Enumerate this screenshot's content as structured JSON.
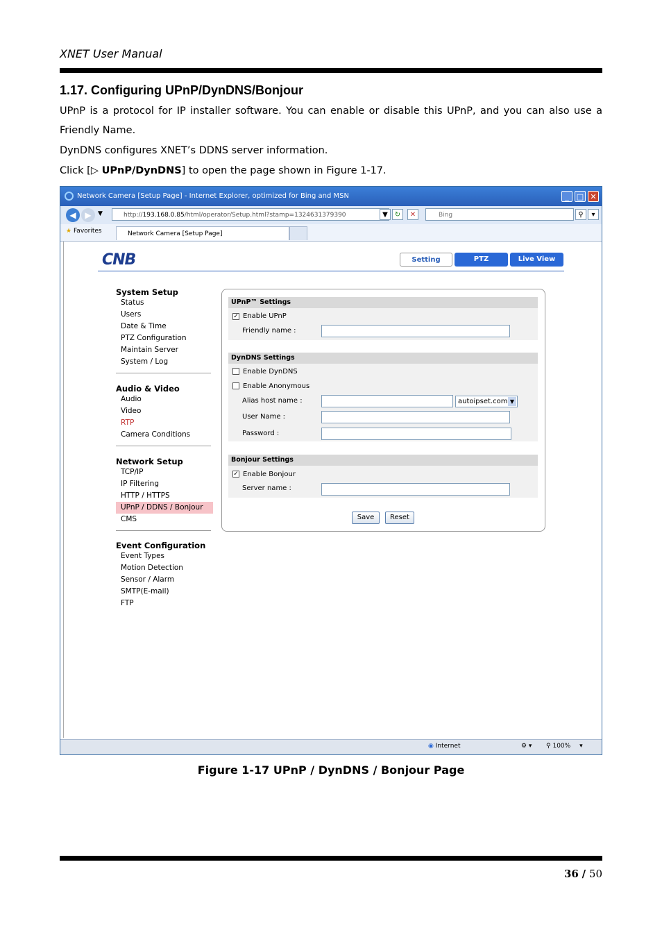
{
  "header": {
    "title": "XNET User Manual"
  },
  "section": {
    "title": "1.17. Configuring UPnP/DynDNS/Bonjour",
    "p1": "UPnP is a protocol for IP installer software. You can enable or disable this UPnP, and you can also use a Friendly Name.",
    "p2": "DynDNS configures XNET’s DDNS server information.",
    "p3_pre": "Click [",
    "p3_icon": "▷",
    "p3_bold": "UPnP/DynDNS",
    "p3_post": "] to open the page shown in Figure 1-17."
  },
  "browser": {
    "window_title": "Network Camera [Setup Page] - Internet Explorer, optimized for Bing and MSN",
    "address_prefix": "http://",
    "address_host": "193.168.0.85",
    "address_rest": "/html/operator/Setup.html?stamp=1324631379390",
    "search_placeholder": "Bing",
    "favorites_label": "Favorites",
    "tab_label": "Network Camera [Setup Page]",
    "status_zone": "Internet",
    "zoom": "100%"
  },
  "camera_ui": {
    "logo": "CNB",
    "tabs": {
      "setting": "Setting",
      "ptz": "PTZ",
      "live": "Live View"
    },
    "menu": {
      "system_setup": {
        "title": "System Setup",
        "items": [
          "Status",
          "Users",
          "Date & Time",
          "PTZ Configuration",
          "Maintain Server",
          "System / Log"
        ]
      },
      "audio_video": {
        "title": "Audio & Video",
        "items": [
          "Audio",
          "Video",
          "RTP",
          "Camera Conditions"
        ]
      },
      "network_setup": {
        "title": "Network Setup",
        "items": [
          "TCP/IP",
          "IP Filtering",
          "HTTP / HTTPS",
          "UPnP / DDNS / Bonjour",
          "CMS"
        ]
      },
      "event_config": {
        "title": "Event Configuration",
        "items": [
          "Event Types",
          "Motion Detection",
          "Sensor / Alarm",
          "SMTP(E-mail)",
          "FTP"
        ]
      }
    },
    "upnp": {
      "title": "UPnP™ Settings",
      "enable_label": "Enable UPnP",
      "enable_checked": true,
      "friendly_label": "Friendly name :",
      "friendly_value": ""
    },
    "dyndns": {
      "title": "DynDNS Settings",
      "enable_label": "Enable DynDNS",
      "enable_checked": false,
      "anon_label": "Enable Anonymous",
      "anon_checked": false,
      "alias_label": "Alias host name :",
      "alias_value": "",
      "domain_selected": "autoipset.com",
      "user_label": "User Name :",
      "user_value": "",
      "pass_label": "Password :",
      "pass_value": ""
    },
    "bonjour": {
      "title": "Bonjour Settings",
      "enable_label": "Enable Bonjour",
      "enable_checked": true,
      "server_label": "Server name :",
      "server_value": ""
    },
    "buttons": {
      "save": "Save",
      "reset": "Reset"
    }
  },
  "figure_caption": "Figure 1-17 UPnP / DynDNS / Bonjour Page",
  "footer": {
    "page": "36",
    "separator": "/",
    "total": "50"
  }
}
